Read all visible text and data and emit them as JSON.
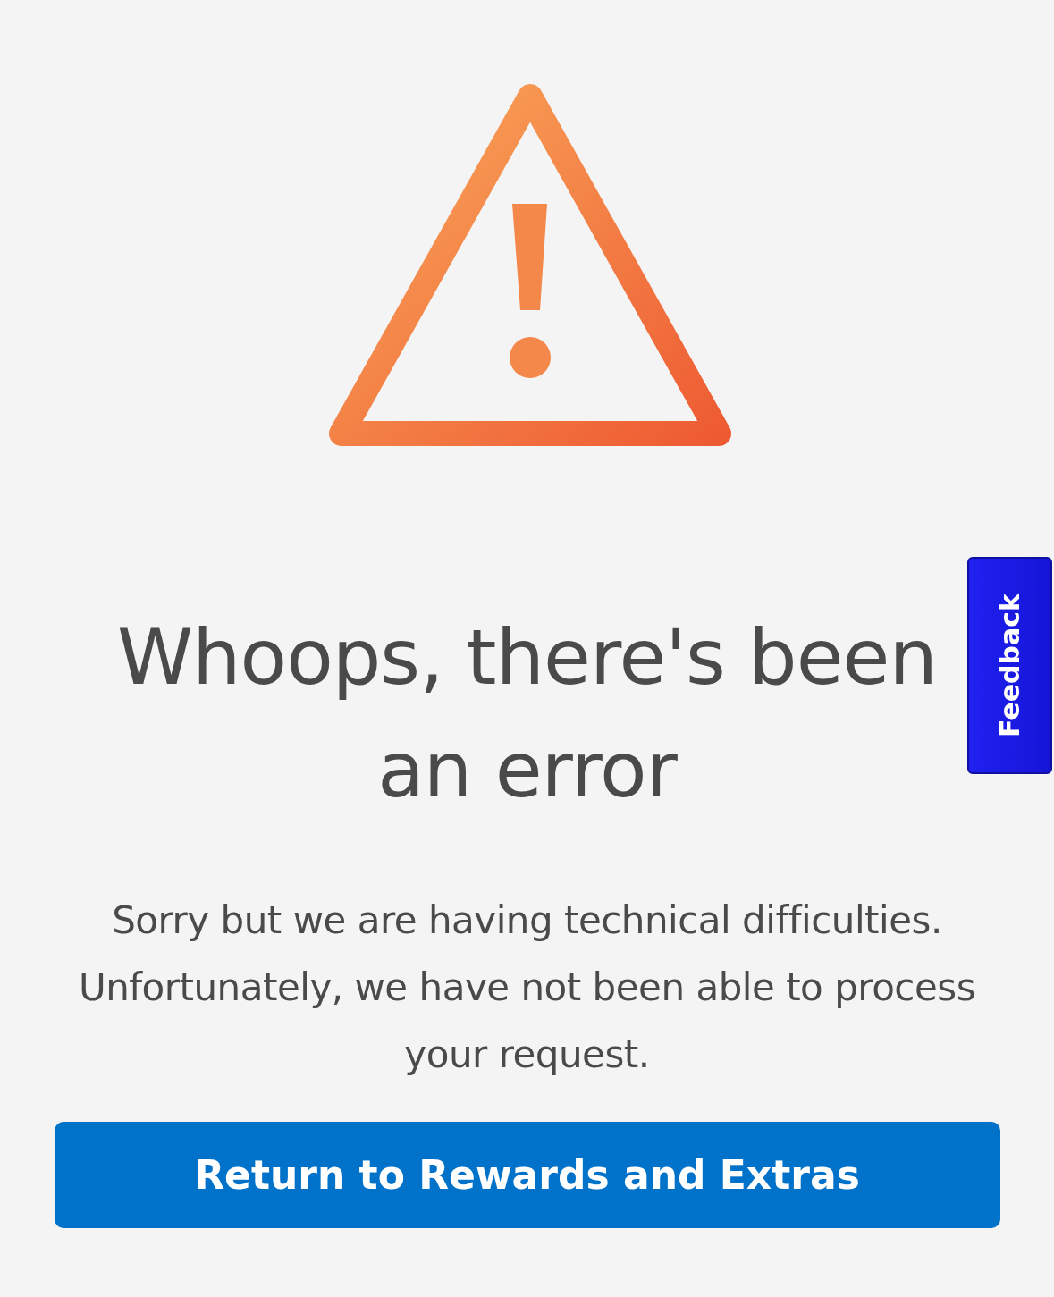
{
  "heading": "Whoops, there's been an error",
  "message": "Sorry but we are having technical difficulties. Unfortunately, we have not been able to process your request.",
  "button": {
    "label": "Return to Rewards and Extras"
  },
  "feedback_tab": {
    "label": "Feedback"
  }
}
